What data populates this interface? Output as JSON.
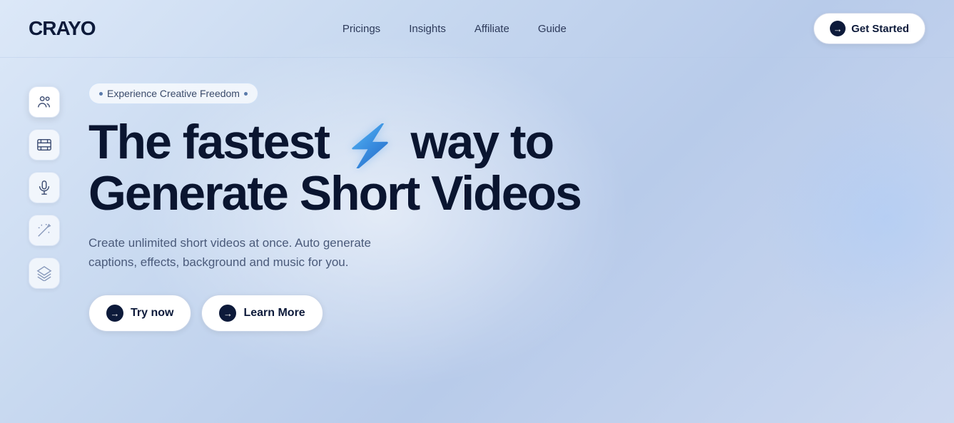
{
  "brand": {
    "logo": "CRAYO"
  },
  "navbar": {
    "links": [
      {
        "id": "pricings",
        "label": "Pricings"
      },
      {
        "id": "insights",
        "label": "Insights"
      },
      {
        "id": "affiliate",
        "label": "Affiliate"
      },
      {
        "id": "guide",
        "label": "Guide"
      }
    ],
    "cta_label": "Get Started"
  },
  "sidebar": {
    "icons": [
      {
        "id": "users-icon",
        "name": "users-icon",
        "active": true
      },
      {
        "id": "film-icon",
        "name": "film-icon",
        "active": false
      },
      {
        "id": "mic-icon",
        "name": "mic-icon",
        "active": false
      },
      {
        "id": "wand-icon",
        "name": "wand-icon",
        "active": false,
        "faded": true
      },
      {
        "id": "layers-icon",
        "name": "layers-icon",
        "active": false,
        "faded": true
      }
    ]
  },
  "hero": {
    "tagline": "Experience Creative Freedom",
    "headline_line1": "The fastest",
    "headline_line2": "way to",
    "headline_line3": "Generate Short Videos",
    "lightning": "⚡",
    "subtext": "Create unlimited short videos at once. Auto generate captions, effects, background and music for you.",
    "cta_primary": "Try now",
    "cta_secondary": "Learn More"
  }
}
